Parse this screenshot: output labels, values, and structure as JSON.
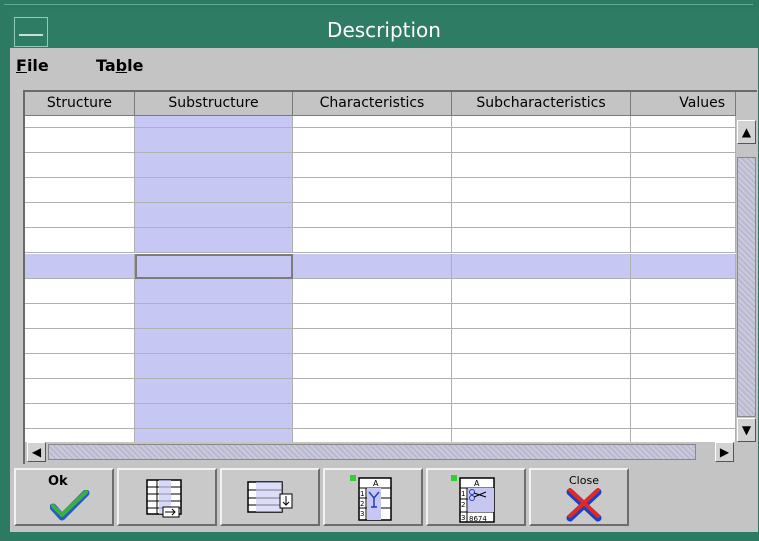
{
  "window": {
    "title": "Description"
  },
  "menubar": {
    "items": [
      {
        "label_pre": "",
        "label_u": "F",
        "label_post": "ile"
      },
      {
        "label_pre": "Ta",
        "label_u": "b",
        "label_post": "le"
      }
    ]
  },
  "table": {
    "columns": [
      "Structure",
      "Substructure",
      "Characteristics",
      "Subcharacteristics",
      "Values"
    ],
    "row_count": 13,
    "selected_row": 4,
    "colors": {
      "highlight": "#c7c7f3",
      "titlebar": "#2e7c63"
    }
  },
  "toolbar": {
    "buttons": [
      {
        "label": "Ok",
        "icon": "ok-check-icon"
      },
      {
        "label": "",
        "icon": "insert-row-icon"
      },
      {
        "label": "",
        "icon": "append-row-icon"
      },
      {
        "label": "",
        "icon": "table-join-icon"
      },
      {
        "label": "",
        "icon": "table-cut-icon",
        "cell_text": "8674"
      },
      {
        "label": "Close",
        "icon": "close-x-icon"
      }
    ]
  }
}
